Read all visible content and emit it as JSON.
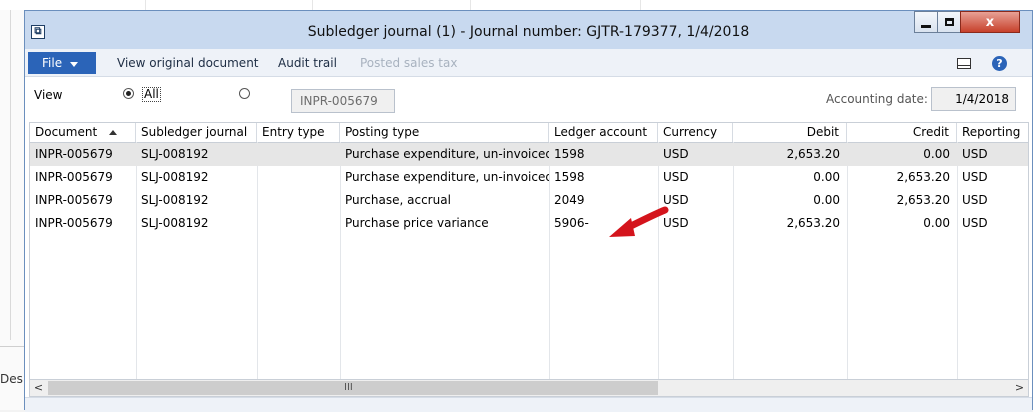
{
  "background": {
    "partial_label": "Des"
  },
  "window": {
    "title": "Subledger journal (1) - Journal number: GJTR-179377, 1/4/2018",
    "close_glyph": "x"
  },
  "toolbar": {
    "file_label": "File",
    "view_original_document": "View original document",
    "audit_trail": "Audit trail",
    "posted_sales_tax": "Posted sales tax",
    "help_glyph": "?"
  },
  "view": {
    "label": "View",
    "option_all": "All",
    "document_value": "INPR-005679",
    "accounting_date_label": "Accounting date:",
    "accounting_date_value": "1/4/2018"
  },
  "grid": {
    "columns": [
      "Document",
      "Subledger journal",
      "Entry type",
      "Posting type",
      "Ledger account",
      "Currency",
      "Debit",
      "Credit",
      "Reporting"
    ],
    "rows": [
      {
        "document": "INPR-005679",
        "subledger_journal": "SLJ-008192",
        "entry_type": "",
        "posting_type": "Purchase expenditure, un-invoiced",
        "ledger_account": "1598",
        "currency": "USD",
        "debit": "2,653.20",
        "credit": "0.00",
        "reporting": "USD"
      },
      {
        "document": "INPR-005679",
        "subledger_journal": "SLJ-008192",
        "entry_type": "",
        "posting_type": "Purchase expenditure, un-invoiced",
        "ledger_account": "1598",
        "currency": "USD",
        "debit": "0.00",
        "credit": "2,653.20",
        "reporting": "USD"
      },
      {
        "document": "INPR-005679",
        "subledger_journal": "SLJ-008192",
        "entry_type": "",
        "posting_type": "Purchase, accrual",
        "ledger_account": "2049",
        "currency": "USD",
        "debit": "0.00",
        "credit": "2,653.20",
        "reporting": "USD"
      },
      {
        "document": "INPR-005679",
        "subledger_journal": "SLJ-008192",
        "entry_type": "",
        "posting_type": "Purchase price variance",
        "ledger_account": "5906-",
        "currency": "USD",
        "debit": "2,653.20",
        "credit": "0.00",
        "reporting": "USD"
      }
    ],
    "selected_row": 0
  },
  "scrollbar": {
    "left_glyph": "<",
    "right_glyph": ">",
    "grip_glyph": "III"
  },
  "colors": {
    "accent": "#2b64b8",
    "titlebar": "#c8d9ef",
    "annotation_arrow": "#d4141c",
    "selected_row": "#e6e6e6"
  }
}
